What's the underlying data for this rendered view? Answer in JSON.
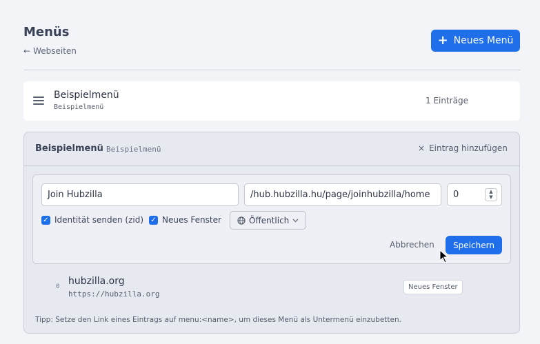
{
  "header": {
    "title": "Menüs",
    "back_label": "Webseiten",
    "new_menu_label": "Neues Menü"
  },
  "menu_list": [
    {
      "title": "Beispielmenü",
      "subtitle": "Beispielmenü",
      "count": "1 Einträge"
    }
  ],
  "panel": {
    "title": "Beispielmenü",
    "subtitle": "Beispielmenü",
    "add_entry_label": "Eintrag hinzufügen",
    "form": {
      "name_value": "Join Hubzilla",
      "url_value": "/hub.hubzilla.hu/page/joinhubzilla/home",
      "order_value": "0",
      "send_identity_label": "Identität senden (zid)",
      "send_identity_checked": true,
      "new_window_label": "Neues Fenster",
      "new_window_checked": true,
      "visibility_label": "Öffentlich",
      "cancel_label": "Abbrechen",
      "save_label": "Speichern"
    },
    "entries": [
      {
        "order": "0",
        "title": "hubzilla.org",
        "url": "https://hubzilla.org",
        "badge": "Neues Fenster"
      }
    ],
    "tip": "Tipp: Setze den Link eines Eintrags auf menu:<name>, um dieses Menü als Untermenü einzubetten."
  },
  "colors": {
    "accent": "#1f6feb",
    "background": "#f2f4f8"
  }
}
